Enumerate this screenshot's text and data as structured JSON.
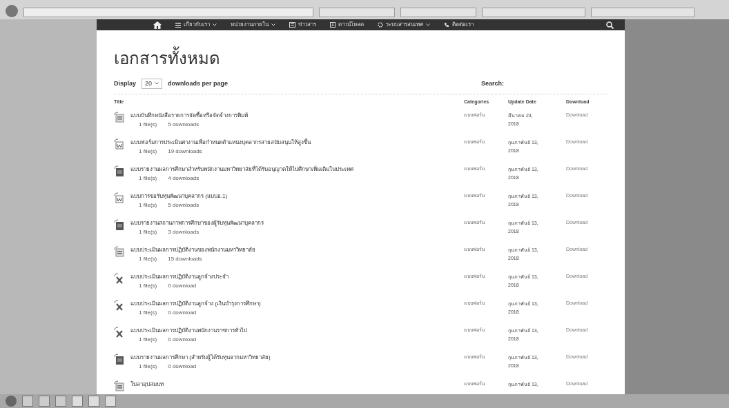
{
  "nav": {
    "items": [
      {
        "label": "เกี่ยวกับเรา",
        "dropdown": true
      },
      {
        "label": "หน่วยงานภายใน",
        "dropdown": true
      },
      {
        "label": "ข่าวสาร",
        "dropdown": false
      },
      {
        "label": "ดาวน์โหลด",
        "dropdown": false
      },
      {
        "label": "ระบบสารสนเทศ",
        "dropdown": true
      },
      {
        "label": "ติดต่อเรา",
        "dropdown": false
      }
    ]
  },
  "page_title": "เอกสารทั้งหมด",
  "display": {
    "before": "Display",
    "value": "20",
    "after": "downloads per page"
  },
  "search": {
    "label": "Search:"
  },
  "table": {
    "columns": [
      "Title",
      "Categories",
      "Update Date",
      "Download"
    ],
    "rows": [
      {
        "kind": "image",
        "title": "แบบบันทึกหนังสือรายการจัดซื้อหรือจัดจ้างการพิมพ์",
        "files": "1 file(s)",
        "downloads": "5 downloads",
        "category": "แบบฟอร์ม",
        "date": "มีนาคม 23, 2018",
        "action": "Download"
      },
      {
        "kind": "word",
        "title": "แบบฟอร์มการประเมินค่างานเพื่อกำหนดตำแหน่งบุคลากรสายสนับสนุนให้สูงขึ้น",
        "files": "1 file(s)",
        "downloads": "19 downloads",
        "category": "แบบฟอร์ม",
        "date": "กุมภาพันธ์ 13, 2018",
        "action": "Download"
      },
      {
        "kind": "picture",
        "title": "แบบรายงานผลการศึกษาสำหรับพนักงานมหาวิทยาลัยที่ได้รับอนุญาตให้ไปศึกษาเพิ่มเติมในประเทศ",
        "files": "1 file(s)",
        "downloads": "4 downloads",
        "category": "แบบฟอร์ม",
        "date": "กุมภาพันธ์ 13, 2018",
        "action": "Download"
      },
      {
        "kind": "word",
        "title": "แบบการขอรับทุนพัฒนาบุคลากร (แบบอ.1)",
        "files": "1 file(s)",
        "downloads": "5 downloads",
        "category": "แบบฟอร์ม",
        "date": "กุมภาพันธ์ 13, 2018",
        "action": "Download"
      },
      {
        "kind": "picture",
        "title": "แบบรายงานสถานภาพการศึกษาของผู้รับทุนพัฒนาบุคลากร",
        "files": "1 file(s)",
        "downloads": "3 downloads",
        "category": "แบบฟอร์ม",
        "date": "กุมภาพันธ์ 13, 2018",
        "action": "Download"
      },
      {
        "kind": "image",
        "title": "แบบประเมินผลการปฏิบัติงานของพนักงานมหาวิทยาลัย",
        "files": "1 file(s)",
        "downloads": "15 downloads",
        "category": "แบบฟอร์ม",
        "date": "กุมภาพันธ์ 13, 2018",
        "action": "Download"
      },
      {
        "kind": "excel",
        "title": "แบบประเมินผลการปฏิบัติงานลูกจ้างประจำ",
        "files": "1 file(s)",
        "downloads": "0 download",
        "category": "แบบฟอร์ม",
        "date": "กุมภาพันธ์ 13, 2018",
        "action": "Download"
      },
      {
        "kind": "excel",
        "title": "แบบประเมินผลการปฏิบัติงานลูกจ้าง (เงินบำรุงการศึกษา)",
        "files": "1 file(s)",
        "downloads": "0 download",
        "category": "แบบฟอร์ม",
        "date": "กุมภาพันธ์ 13, 2018",
        "action": "Download"
      },
      {
        "kind": "excel",
        "title": "แบบประเมินผลการปฏิบัติงานพนักงานราชการทั่วไป",
        "files": "1 file(s)",
        "downloads": "0 download",
        "category": "แบบฟอร์ม",
        "date": "กุมภาพันธ์ 13, 2018",
        "action": "Download"
      },
      {
        "kind": "picture",
        "title": "แบบรายงานผลการศึกษา (สำหรับผู้ได้รับทุนจากมหาวิทยาลัย)",
        "files": "1 file(s)",
        "downloads": "0 download",
        "category": "แบบฟอร์ม",
        "date": "กุมภาพันธ์ 13, 2018",
        "action": "Download"
      },
      {
        "kind": "image",
        "title": "ใบลาอุปสมบท",
        "category": "แบบฟอร์ม",
        "date": "กุมภาพันธ์ 13,",
        "action": "Download"
      }
    ]
  }
}
